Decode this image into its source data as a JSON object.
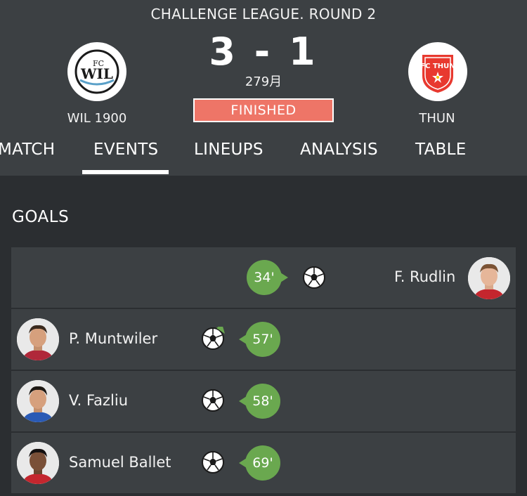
{
  "header": {
    "league_round": "CHALLENGE LEAGUE. ROUND 2",
    "score": "3 - 1",
    "minute": "279月",
    "status": "FINISHED",
    "status_color": "#ee7567",
    "home_team": {
      "name": "WIL 1900",
      "logo_text": "WIL",
      "logo_top": "FC"
    },
    "away_team": {
      "name": "THUN",
      "logo_text": "FC THUN",
      "brand_color": "#e8392f"
    }
  },
  "tabs": [
    {
      "label": "MATCH",
      "active": false
    },
    {
      "label": "EVENTS",
      "active": true
    },
    {
      "label": "LINEUPS",
      "active": false
    },
    {
      "label": "ANALYSIS",
      "active": false
    },
    {
      "label": "TABLE",
      "active": false
    }
  ],
  "goals": {
    "title": "GOALS",
    "accent_color": "#6aa84f",
    "events": [
      {
        "side": "away",
        "minute": "34'",
        "player": "F. Rudlin",
        "icon": "soccer-ball-icon"
      },
      {
        "side": "home",
        "minute": "57'",
        "player": "P. Muntwiler",
        "icon": "soccer-ball-assist-icon"
      },
      {
        "side": "home",
        "minute": "58'",
        "player": "V. Fazliu",
        "icon": "soccer-ball-icon"
      },
      {
        "side": "home",
        "minute": "69'",
        "player": "Samuel Ballet",
        "icon": "soccer-ball-icon"
      }
    ]
  }
}
